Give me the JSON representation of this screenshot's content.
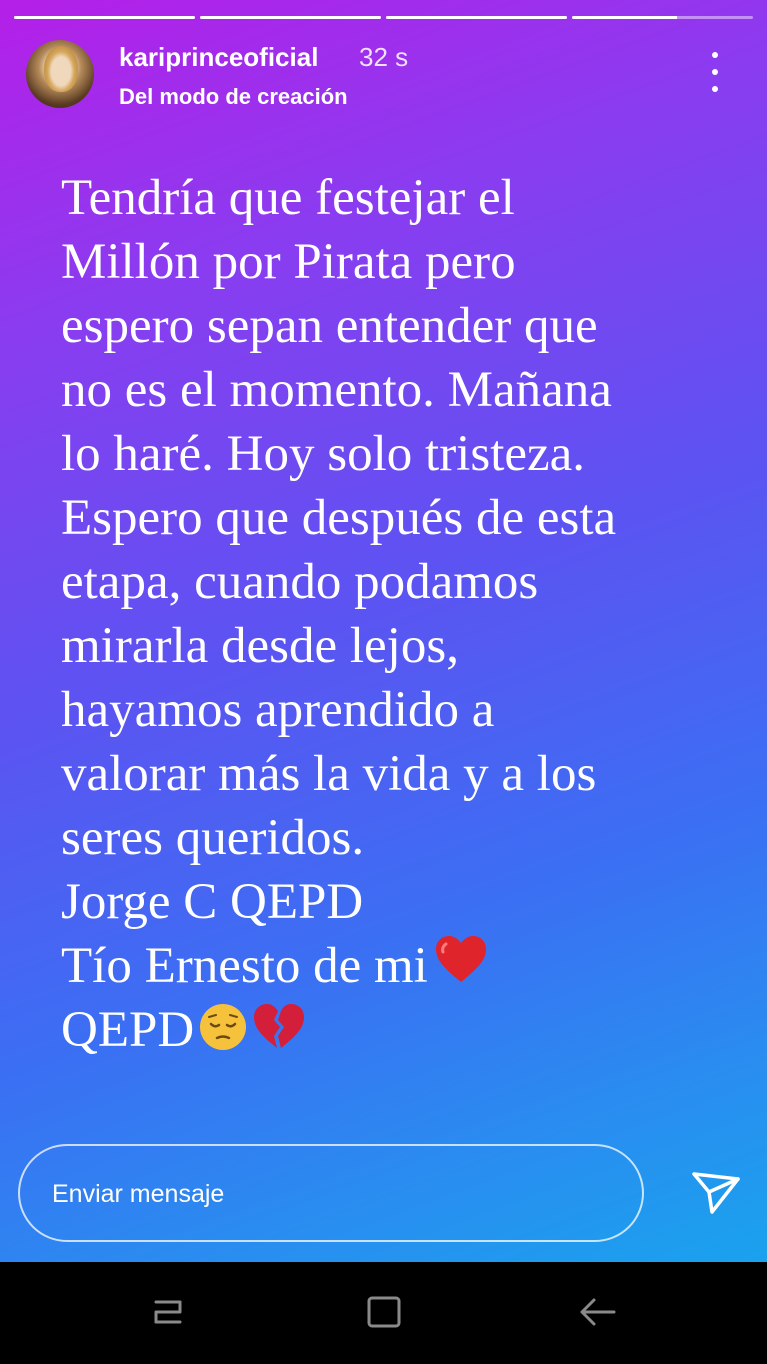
{
  "story": {
    "username": "kariprinceoficial",
    "time_ago": "32 s",
    "source": "Del modo de creación",
    "progress": [
      1,
      1,
      1,
      0.58
    ],
    "caption_lines": [
      "Tendría que festejar el",
      "Millón por Pirata pero",
      "espero sepan entender que",
      "no es el momento. Mañana",
      "lo haré. Hoy solo tristeza.",
      "Espero que después de esta",
      "etapa, cuando podamos",
      "mirarla desde lejos,",
      "hayamos aprendido a",
      "valorar más la vida y a los",
      "seres queridos.",
      "Jorge C QEPD",
      "Tío Ernesto de mi",
      "QEPD"
    ],
    "icons": {
      "heart_emoji": "red-heart-icon",
      "pensive_emoji": "pensive-face-icon",
      "broken_heart_emoji": "broken-heart-icon"
    }
  },
  "reply": {
    "placeholder": "Enviar mensaje"
  },
  "nav": {
    "buttons": [
      "recents-icon",
      "home-icon",
      "back-icon"
    ]
  },
  "colors": {
    "gradient_top": "#b51fe8",
    "gradient_mid": "#5b54f2",
    "gradient_bottom": "#1aa2ee",
    "heart": "#e0242c"
  }
}
